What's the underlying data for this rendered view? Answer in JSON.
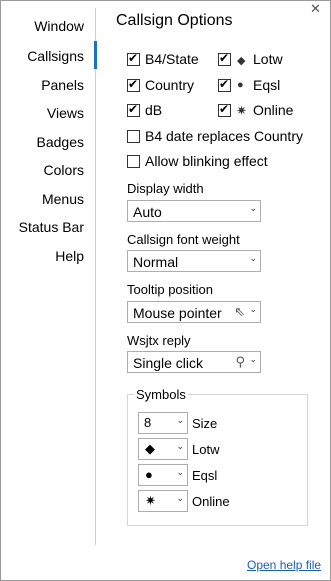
{
  "window": {
    "close_glyph": "✕"
  },
  "nav": {
    "items": [
      "Window",
      "Callsigns",
      "Panels",
      "Views",
      "Badges",
      "Colors",
      "Menus",
      "Status Bar",
      "Help"
    ],
    "selected": "Callsigns",
    "accent": "#1a73c9"
  },
  "panel": {
    "title": "Callsign Options",
    "checkboxes": [
      {
        "label": "B4/State",
        "checked": true
      },
      {
        "label": "Lotw",
        "checked": true,
        "icon": "diamond-icon",
        "glyph": "◆"
      },
      {
        "label": "Country",
        "checked": true
      },
      {
        "label": "Eqsl",
        "checked": true,
        "icon": "circle-icon",
        "glyph": "●"
      },
      {
        "label": "dB",
        "checked": true
      },
      {
        "label": "Online",
        "checked": true,
        "icon": "star-icon",
        "glyph": "✷"
      },
      {
        "label": "B4 date replaces Country",
        "checked": false
      },
      {
        "label": "Allow blinking effect",
        "checked": false
      }
    ],
    "display_width": {
      "label": "Display width",
      "value": "Auto"
    },
    "font_weight": {
      "label": "Callsign font weight",
      "value": "Normal"
    },
    "tooltip": {
      "label": "Tooltip position",
      "value": "Mouse pointer",
      "icon": "cursor-icon"
    },
    "wsjtx": {
      "label": "Wsjtx reply",
      "value": "Single click",
      "icon": "click-icon"
    },
    "symbols": {
      "title": "Symbols",
      "rows": [
        {
          "value": "8",
          "label": "Size"
        },
        {
          "value": "◆",
          "label": "Lotw",
          "icon": "diamond-icon"
        },
        {
          "value": "●",
          "label": "Eqsl",
          "icon": "circle-icon"
        },
        {
          "value": "✷",
          "label": "Online",
          "icon": "star-icon"
        }
      ]
    }
  },
  "footer": {
    "help_link": "Open help file",
    "link_color": "#1a5fb4"
  }
}
